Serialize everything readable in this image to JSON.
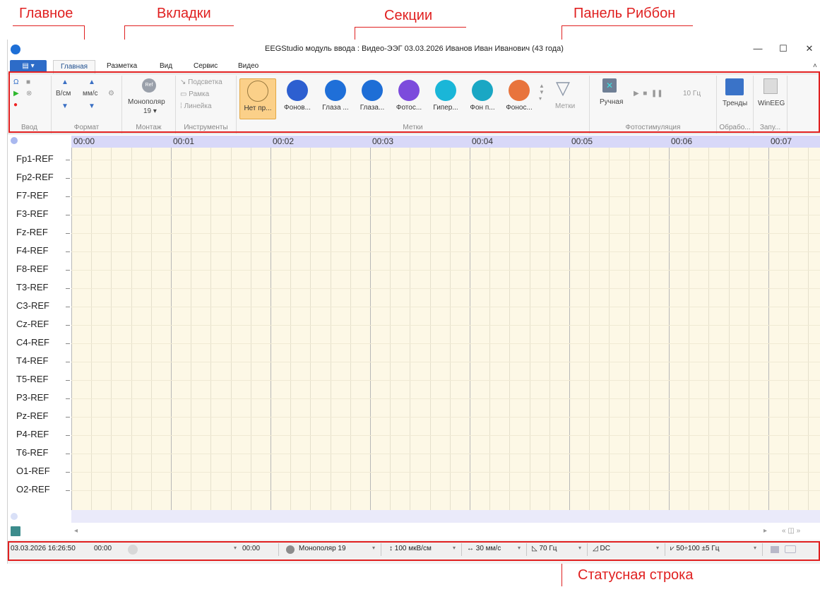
{
  "annotations": {
    "main": "Главное",
    "tabs": "Вкладки",
    "sections": "Секции",
    "ribbon_panel": "Панель Риббон",
    "status_bar": "Статусная строка"
  },
  "window": {
    "title": "EEGStudio модуль ввода : Видео-ЭЭГ 03.03.2026 Иванов Иван Иванович (43 года)",
    "minimize": "—",
    "maximize": "☐",
    "close": "✕"
  },
  "tabs": [
    {
      "label": "Главная"
    },
    {
      "label": "Разметка"
    },
    {
      "label": "Вид"
    },
    {
      "label": "Сервис"
    },
    {
      "label": "Видео"
    }
  ],
  "ribbon": {
    "groups": {
      "input": "Ввод",
      "format": "Формат",
      "montage": "Монтаж",
      "tools": "Инструменты",
      "marks": "Метки",
      "photostim": "Фотостимуляция",
      "processing": "Обрабо...",
      "launch": "Запу..."
    },
    "format": {
      "v_cm": "В/см",
      "mm_s": "мм/с"
    },
    "montage": {
      "label": "Монополяр",
      "count": "19 ▾",
      "ref": "Ref"
    },
    "tools": {
      "highlight": "Подсветка",
      "frame": "Рамка",
      "ruler": "Линейка"
    },
    "marks": [
      {
        "label": "Нет пр...",
        "color": "#ffffff"
      },
      {
        "label": "Фонов...",
        "color": "#2d5fd0"
      },
      {
        "label": "Глаза ...",
        "color": "#1f6fd8"
      },
      {
        "label": "Глаза...",
        "color": "#1e6ed6"
      },
      {
        "label": "Фотос...",
        "color": "#7c4bdc"
      },
      {
        "label": "Гипер...",
        "color": "#1ab6d8"
      },
      {
        "label": "Фон п...",
        "color": "#1aa7c4"
      },
      {
        "label": "Фонос...",
        "color": "#e8743c"
      }
    ],
    "marks_dropdown": "Метки",
    "photostim": {
      "mode": "Ручная",
      "freq": "10 Гц"
    },
    "trends": "Тренды",
    "wineeg": "WinEEG"
  },
  "timeline": [
    "00:00",
    "00:01",
    "00:02",
    "00:03",
    "00:04",
    "00:05",
    "00:06",
    "00:07"
  ],
  "channels": [
    "Fp1-REF",
    "Fp2-REF",
    "F7-REF",
    "F3-REF",
    "Fz-REF",
    "F4-REF",
    "F8-REF",
    "T3-REF",
    "C3-REF",
    "Cz-REF",
    "C4-REF",
    "T4-REF",
    "T5-REF",
    "P3-REF",
    "Pz-REF",
    "P4-REF",
    "T6-REF",
    "O1-REF",
    "O2-REF"
  ],
  "status": {
    "datetime": "03.03.2026 16:26:50",
    "time1": "00:00",
    "time2": "00:00",
    "montage": "Монополяр 19",
    "sensitivity": "100 мкВ/см",
    "speed": "30 мм/с",
    "lowpass": "70 Гц",
    "highpass": "DC",
    "notch": "50÷100 ±5 Гц"
  }
}
